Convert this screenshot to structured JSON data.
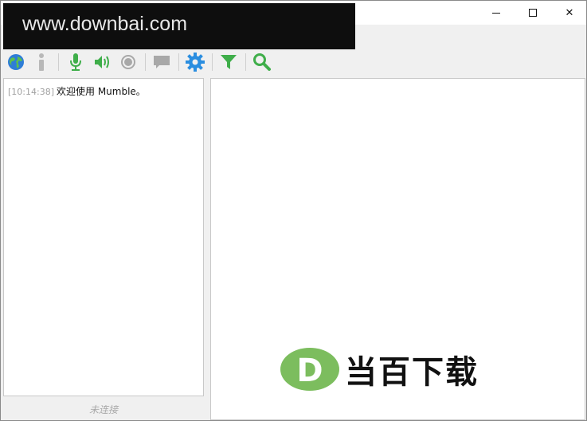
{
  "watermark": {
    "text": "www.downbai.com"
  },
  "titlebar": {
    "minimize_label": "",
    "close_glyph": "✕"
  },
  "toolbar": {
    "items": [
      {
        "icon": "globe-icon",
        "color": "#2e7dd7"
      },
      {
        "icon": "info-icon",
        "color": "#b8b8b8"
      },
      {
        "icon": "microphone-icon",
        "color": "#3fae4a"
      },
      {
        "icon": "speaker-icon",
        "color": "#3fae4a"
      },
      {
        "icon": "record-icon",
        "color": "#a8a8a8"
      },
      {
        "icon": "comment-icon",
        "color": "#a8a8a8"
      },
      {
        "icon": "gear-icon",
        "color": "#2b8ee0"
      },
      {
        "icon": "filter-icon",
        "color": "#3fae4a"
      },
      {
        "icon": "search-icon",
        "color": "#3fae4a"
      }
    ]
  },
  "log": {
    "entries": [
      {
        "time": "[10:14:38]",
        "message": "欢迎使用 Mumble。"
      }
    ]
  },
  "status": {
    "text": "未连接"
  },
  "brand_watermark": {
    "letter": "D",
    "text": "当百下载",
    "color": "#7cbd5e"
  }
}
